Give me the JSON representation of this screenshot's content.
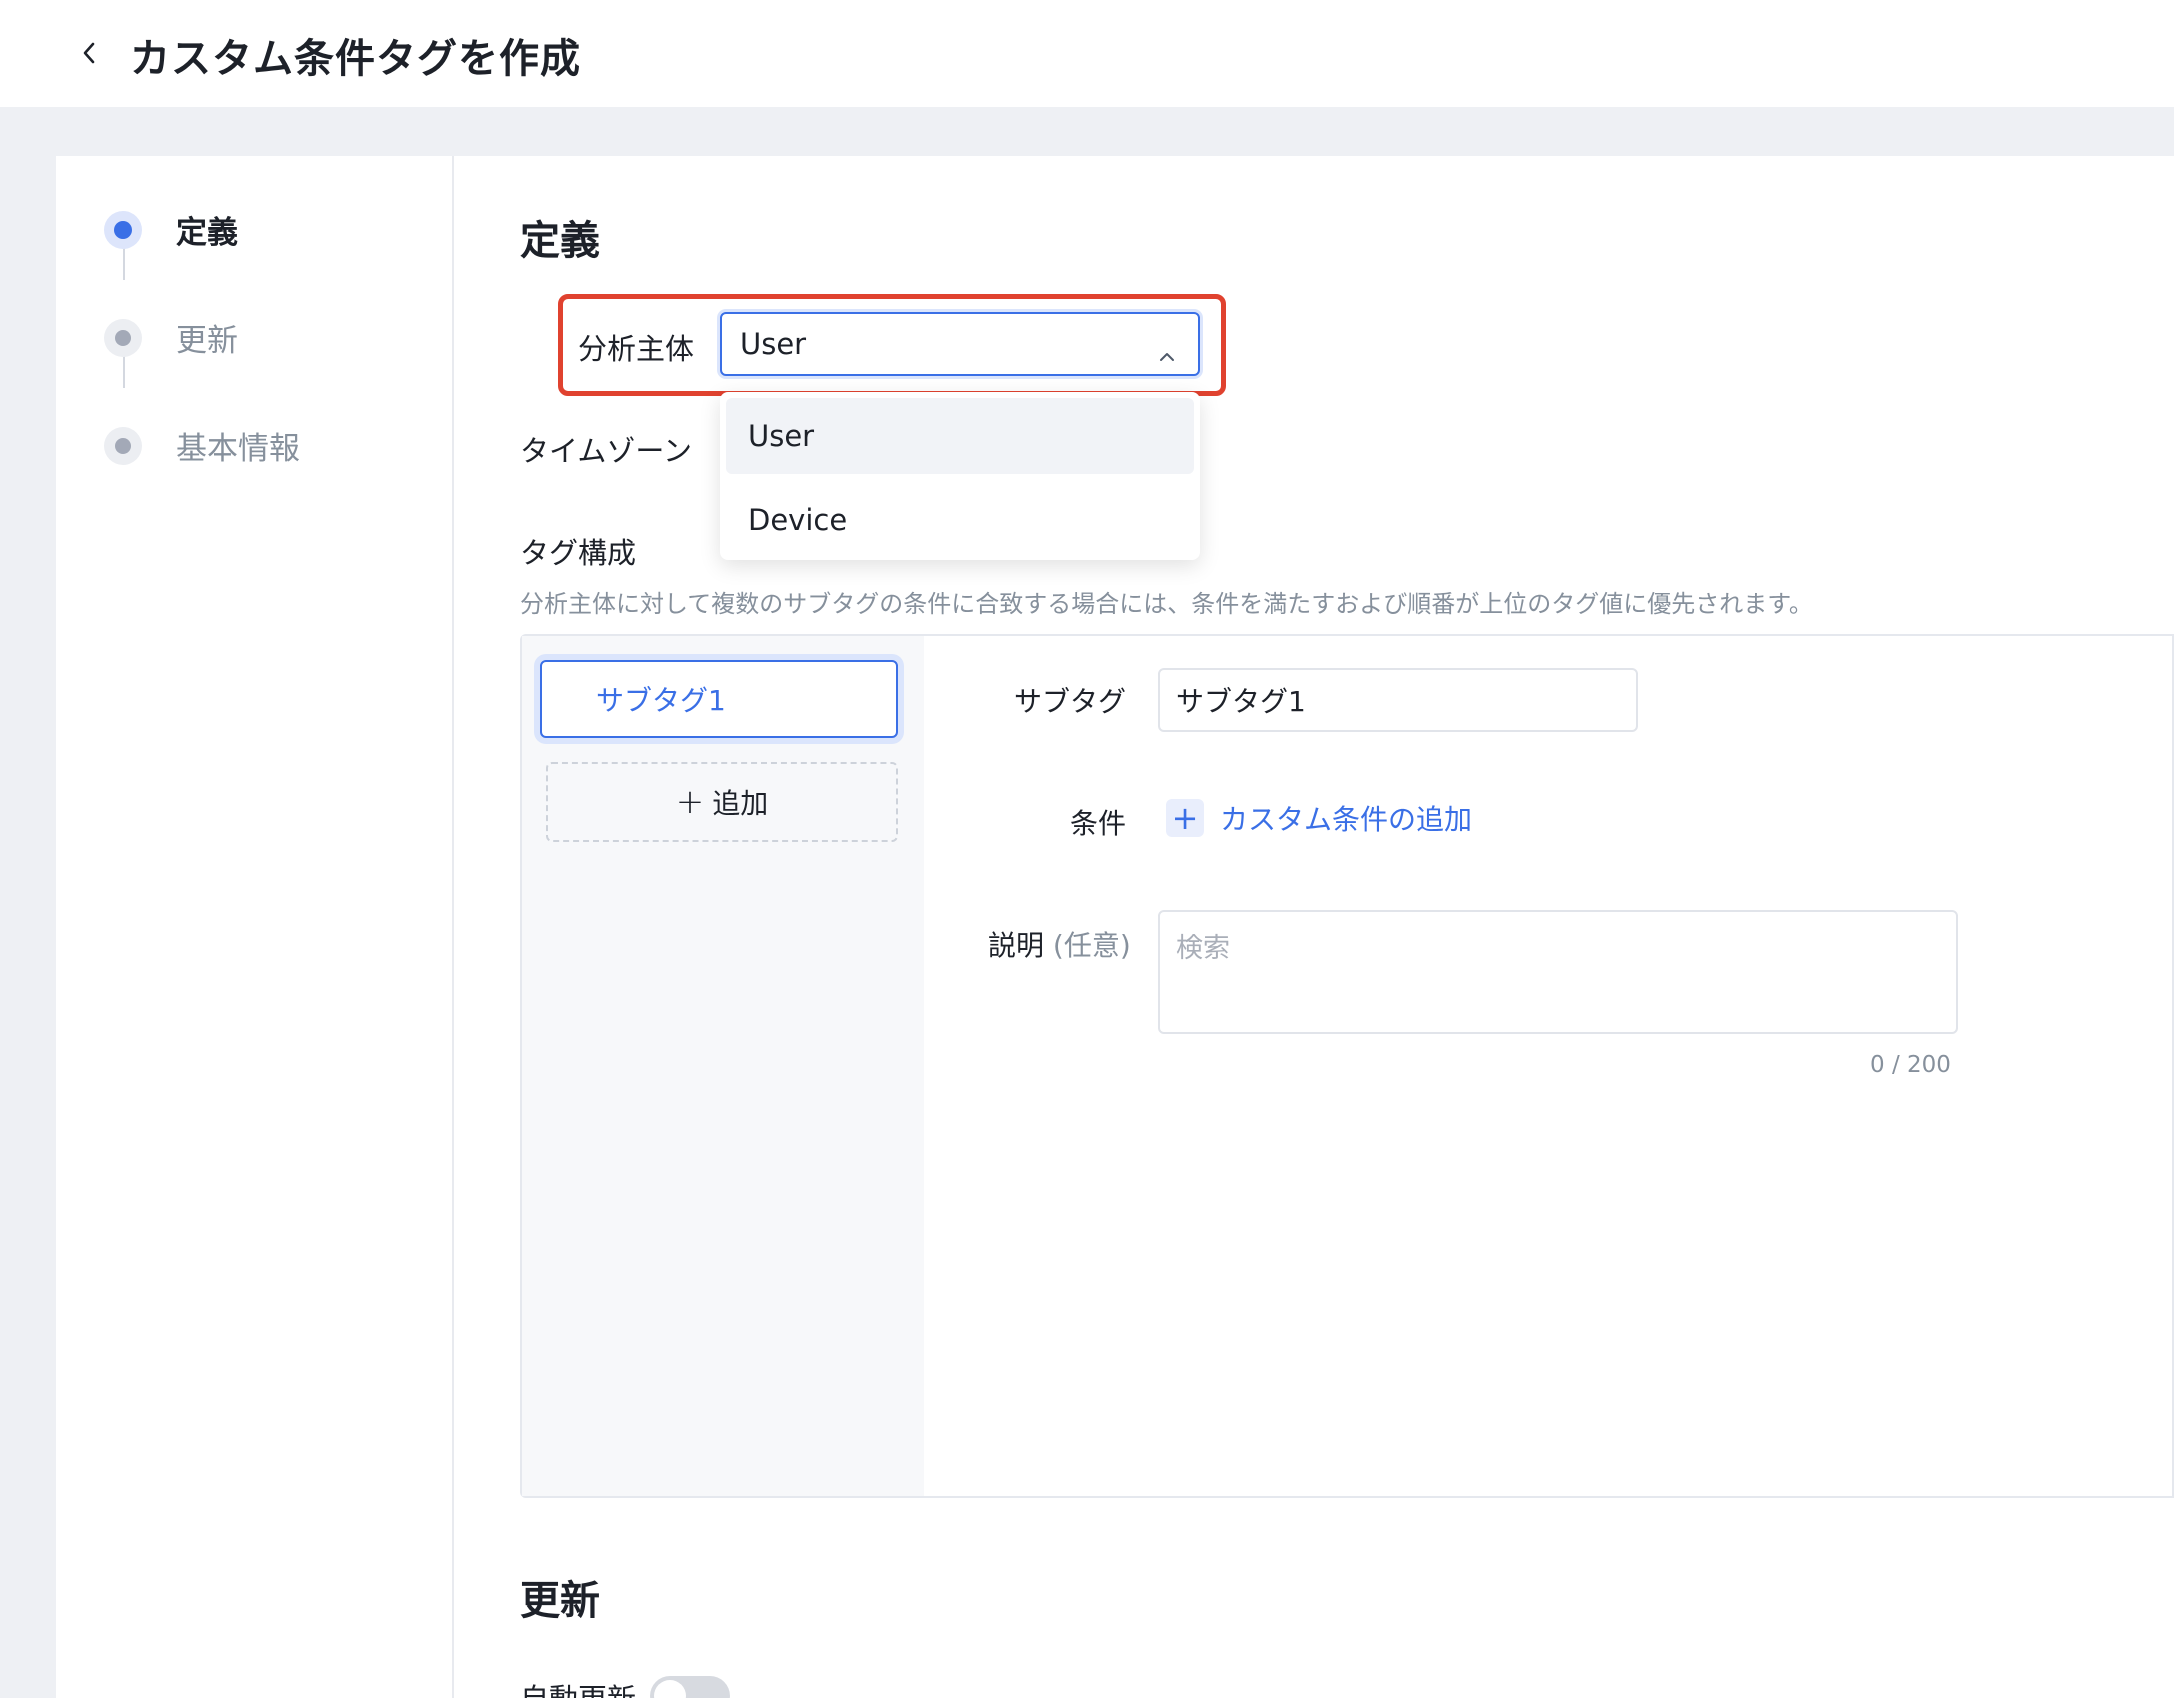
{
  "header": {
    "title": "カスタム条件タグを作成"
  },
  "steps": [
    {
      "label": "定義",
      "state": "active"
    },
    {
      "label": "更新",
      "state": "pending"
    },
    {
      "label": "基本情報",
      "state": "pending"
    }
  ],
  "definition": {
    "section_title": "定義",
    "subject_label": "分析主体",
    "subject_value": "User",
    "subject_options": [
      "User",
      "Device"
    ],
    "timezone_label": "タイムゾーン",
    "tag_config_label": "タグ構成",
    "tag_config_hint": "分析主体に対して複数のサブタグの条件に合致する場合には、条件を満たすおよび順番が上位のタグ値に優先されます。",
    "subtags": [
      "サブタグ1"
    ],
    "add_label": "追加",
    "subtag_label": "サブタグ",
    "subtag_value": "サブタグ1",
    "condition_label": "条件",
    "add_condition_label": "カスタム条件の追加",
    "description_label": "説明",
    "description_optional": "(任意)",
    "description_placeholder": "検索",
    "description_counter": "0 / 200"
  },
  "update": {
    "section_title": "更新",
    "auto_update_label": "自動更新",
    "auto_update_on": false
  },
  "colors": {
    "accent": "#3a6fe6",
    "highlight": "#e0422f"
  }
}
